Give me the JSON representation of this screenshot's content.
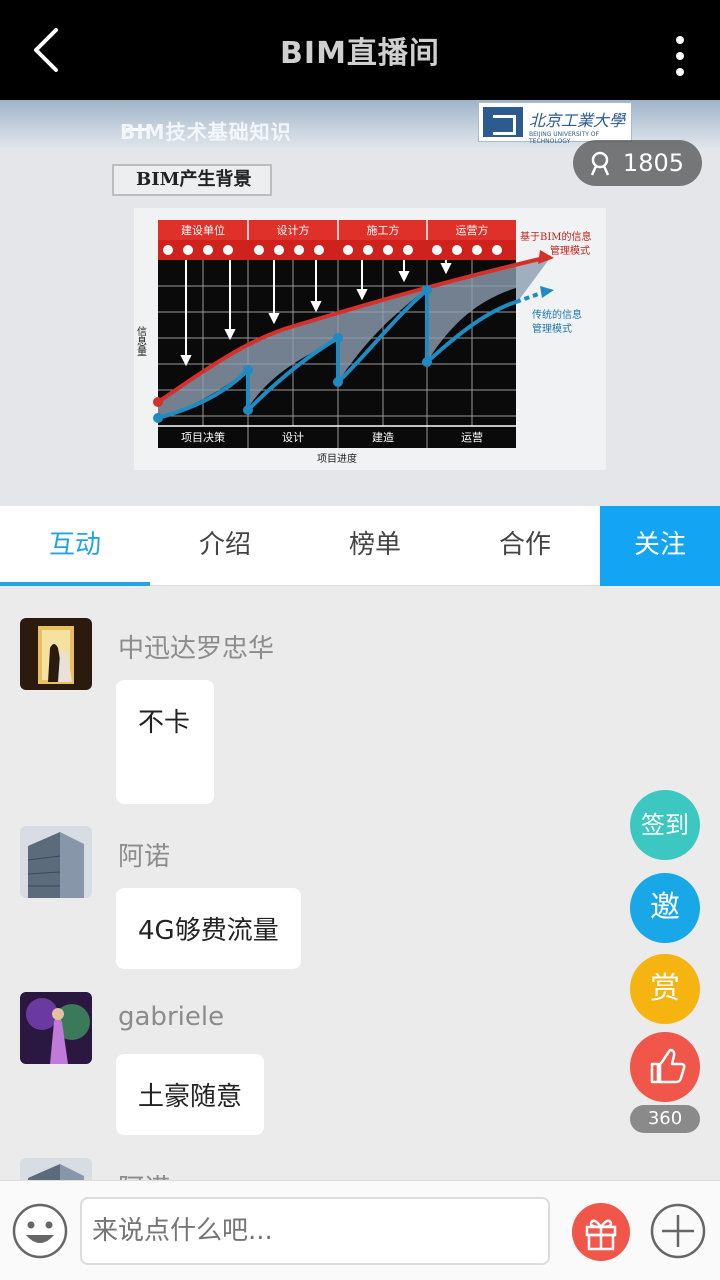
{
  "header": {
    "title": "BIM直播间"
  },
  "video": {
    "heading": "BIM技术基础知识",
    "logo_text": "北京工業大學",
    "logo_sub": "BEIJING UNIVERSITY OF TECHNOLOGY",
    "viewer_count": "1805",
    "slide_title": "BIM产生背景",
    "chart": {
      "top_labels": [
        "建设单位",
        "设计方",
        "施工方",
        "运营方"
      ],
      "bottom_labels": [
        "项目决策",
        "设计",
        "建造",
        "运营"
      ],
      "y_label": "信息量",
      "x_label": "项目进度",
      "red_label_1": "基于BIM的信息",
      "red_label_2": "管理模式",
      "blue_label_1": "传统的信息",
      "blue_label_2": "管理模式"
    }
  },
  "tabs": [
    {
      "label": "互动",
      "active": true
    },
    {
      "label": "介绍"
    },
    {
      "label": "榜单"
    },
    {
      "label": "合作"
    }
  ],
  "follow_label": "关注",
  "chat": {
    "messages": [
      {
        "user": "中迅达罗忠华",
        "text": "不卡"
      },
      {
        "user": "阿诺",
        "text": "4G够费流量"
      },
      {
        "user": "gabriele",
        "text": "土豪随意"
      },
      {
        "user": "阿诺",
        "text": ""
      }
    ]
  },
  "fabs": {
    "checkin": "签到",
    "invite": "邀",
    "reward": "赏",
    "like_count": "360"
  },
  "colors": {
    "accent": "#1ea6e6",
    "checkin": "#3cc8c0",
    "invite": "#18a8e8",
    "reward": "#f5b40f",
    "like": "#f0564a"
  },
  "input": {
    "placeholder": "来说点什么吧..."
  }
}
